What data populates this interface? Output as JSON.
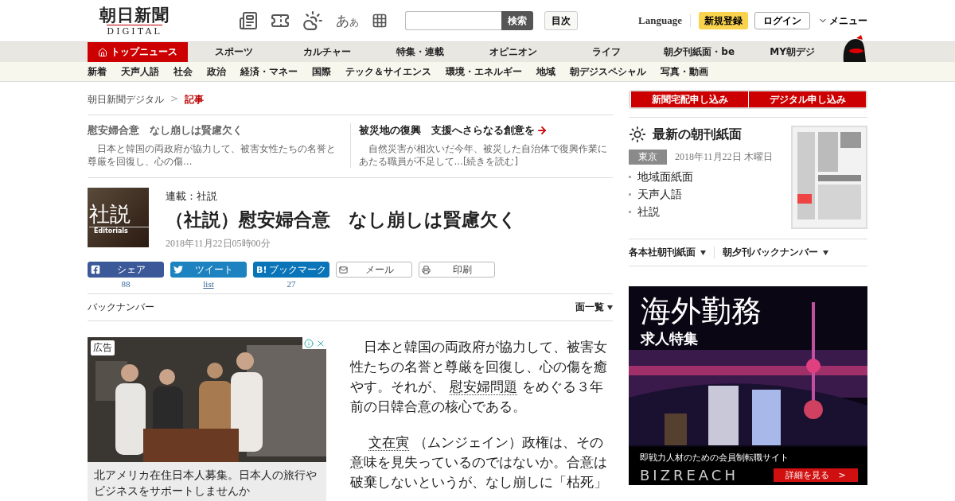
{
  "header": {
    "logo": {
      "title": "朝日新聞",
      "subtitle": "DIGITAL"
    },
    "font_size_button": {
      "large": "あ",
      "small": "あ"
    },
    "search": {
      "button": "検索"
    },
    "index_button": "目次",
    "language": "Language",
    "signup": "新規登録",
    "login": "ログイン",
    "menu": "メニュー"
  },
  "main_nav": [
    {
      "label": "トップニュース",
      "selected": true
    },
    {
      "label": "スポーツ",
      "selected": false
    },
    {
      "label": "カルチャー",
      "selected": false
    },
    {
      "label": "特集・連載",
      "selected": false
    },
    {
      "label": "オピニオン",
      "selected": false
    },
    {
      "label": "ライフ",
      "selected": false
    },
    {
      "label": "朝夕刊紙面・be",
      "selected": false
    },
    {
      "label": "MY朝デジ",
      "selected": false
    }
  ],
  "sub_nav": [
    "新着",
    "天声人語",
    "社会",
    "政治",
    "経済・マネー",
    "国際",
    "テック＆サイエンス",
    "環境・エネルギー",
    "地域",
    "朝デジスペシャル",
    "写真・動画"
  ],
  "breadcrumb": {
    "items": [
      "朝日新聞デジタル",
      "記事"
    ],
    "separator": ">"
  },
  "related": [
    {
      "title": "慰安婦合意　なし崩しは賢慮欠く",
      "summary": "　日本と韓国の両政府が協力して、被害女性たちの名誉と尊厳を回復し、心の傷…",
      "current": true
    },
    {
      "title": "被災地の復興　支援へさらなる創意を",
      "summary": "　自然災害が相次いだ今年、被災した自治体で復興作業にあたる職員が不足して…[続きを読む]",
      "current": false
    }
  ],
  "article": {
    "thumbnail": {
      "title": "社説",
      "subtitle": "Editorials"
    },
    "series": "連載：社説",
    "title": "（社説）慰安婦合意　なし崩しは賢慮欠く",
    "date": "2018年11月22日05時00分"
  },
  "share": [
    {
      "kind": "facebook",
      "label": "シェア",
      "count": "88"
    },
    {
      "kind": "twitter",
      "label": "ツイート",
      "count": "list"
    },
    {
      "kind": "hatena",
      "mark": "B!",
      "label": "ブックマーク",
      "count": "27"
    },
    {
      "kind": "mail",
      "label": "メール"
    },
    {
      "kind": "print",
      "label": "印刷"
    }
  ],
  "backnumber": {
    "label": "バックナンバー",
    "dropdown": "面一覧"
  },
  "ad": {
    "badge": "広告",
    "caption": "北アメリカ在住日本人募集。日本人の旅行やビジネスをサポートしませんか"
  },
  "body": [
    [
      {
        "text": "日本と韓国の両政府が協力して、被害女性たちの名誉と尊厳を回復し、心の傷を癒やす。それが、",
        "link": false
      },
      {
        "text": "慰安婦問題",
        "link": true
      },
      {
        "text": "をめぐる３年前の日韓合意の核心である。",
        "link": false
      }
    ],
    [
      {
        "text": "文在寅",
        "link": true
      },
      {
        "text": "（ムンジェイン）政権は、その意味を見失っているのではないか。合意は破棄しないというが、なし崩しに「枯死」",
        "link": false
      }
    ]
  ],
  "sidebar": {
    "subscribe": [
      "新聞宅配申し込み",
      "デジタル申し込み"
    ],
    "paper": {
      "heading": "最新の朝刊紙面",
      "region": "東京",
      "date": "2018年11月22日 木曜日",
      "links": [
        "地域面紙面",
        "天声人語",
        "社説"
      ]
    },
    "menus": [
      "各本社朝刊紙面",
      "朝夕刊バックナンバー"
    ],
    "ad": {
      "headline": "海外勤務",
      "subheadline": "求人特集",
      "tagline": "即戦力人材のための会員制転職サイト",
      "brand": "BIZREACH",
      "button": "詳細を見る　>"
    }
  }
}
